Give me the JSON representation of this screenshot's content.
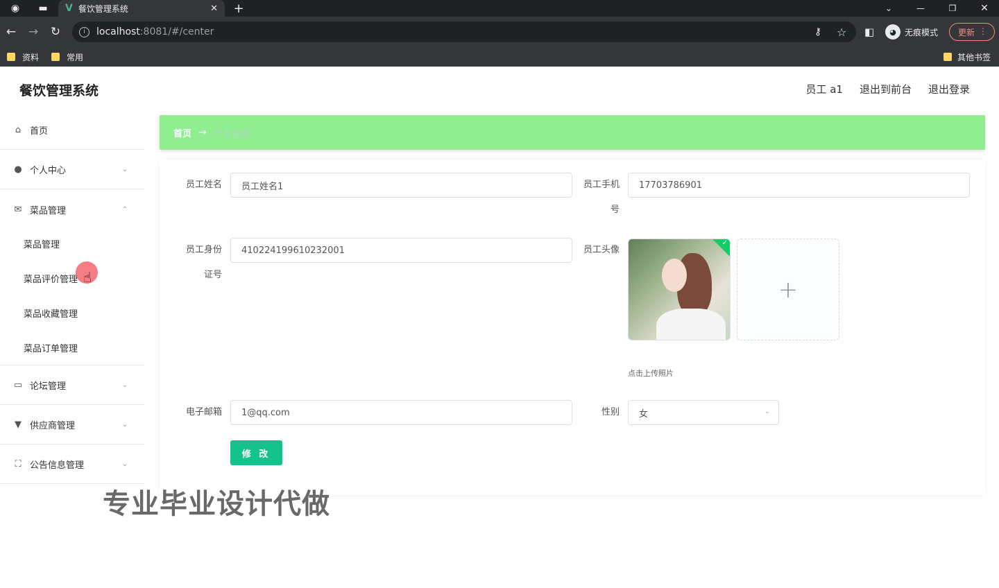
{
  "browser": {
    "tab_title": "餐饮管理系统",
    "tab_close": "✕",
    "new_tab": "+",
    "url_host": "localhost",
    "url_path": ":8081/#/center",
    "incognito_label": "无痕模式",
    "update_label": "更新",
    "bookmarks": [
      "资料",
      "常用"
    ],
    "other_bookmarks": "其他书签"
  },
  "app": {
    "title": "餐饮管理系统",
    "header_links": {
      "user": "员工 a1",
      "front": "退出到前台",
      "logout": "退出登录"
    }
  },
  "sidebar": {
    "items": [
      {
        "label": "首页",
        "icon": "home-icon"
      },
      {
        "label": "个人中心",
        "icon": "user-icon"
      },
      {
        "label": "菜品管理",
        "icon": "mail-icon"
      },
      {
        "label": "论坛管理",
        "icon": "chat-icon"
      },
      {
        "label": "供应商管理",
        "icon": "stamp-icon"
      },
      {
        "label": "公告信息管理",
        "icon": "frame-icon"
      }
    ],
    "sub_items": [
      "菜品管理",
      "菜品评价管理",
      "菜品收藏管理",
      "菜品订单管理"
    ]
  },
  "breadcrumb": {
    "home": "首页",
    "separator": "→",
    "current": "个人信息"
  },
  "form": {
    "name_label": "员工姓名",
    "name_value": "员工姓名1",
    "phone_label_1": "员工手机",
    "phone_label_2": "号",
    "phone_value": "17703786901",
    "id_label_1": "员工身份",
    "id_label_2": "证号",
    "id_value": "410224199610232001",
    "avatar_label": "员工头像",
    "upload_plus": "+",
    "upload_tip": "点击上传照片",
    "email_label": "电子邮箱",
    "email_value": "1@qq.com",
    "gender_label": "性别",
    "gender_value": "女",
    "submit_label": "修 改"
  },
  "watermark": "专业毕业设计代做"
}
